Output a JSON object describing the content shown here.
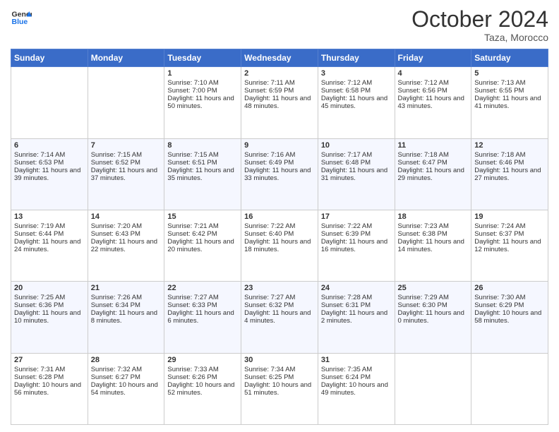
{
  "header": {
    "logo_line1": "General",
    "logo_line2": "Blue",
    "month": "October 2024",
    "location": "Taza, Morocco"
  },
  "days_of_week": [
    "Sunday",
    "Monday",
    "Tuesday",
    "Wednesday",
    "Thursday",
    "Friday",
    "Saturday"
  ],
  "weeks": [
    [
      {
        "day": "",
        "sunrise": "",
        "sunset": "",
        "daylight": ""
      },
      {
        "day": "",
        "sunrise": "",
        "sunset": "",
        "daylight": ""
      },
      {
        "day": "1",
        "sunrise": "Sunrise: 7:10 AM",
        "sunset": "Sunset: 7:00 PM",
        "daylight": "Daylight: 11 hours and 50 minutes."
      },
      {
        "day": "2",
        "sunrise": "Sunrise: 7:11 AM",
        "sunset": "Sunset: 6:59 PM",
        "daylight": "Daylight: 11 hours and 48 minutes."
      },
      {
        "day": "3",
        "sunrise": "Sunrise: 7:12 AM",
        "sunset": "Sunset: 6:58 PM",
        "daylight": "Daylight: 11 hours and 45 minutes."
      },
      {
        "day": "4",
        "sunrise": "Sunrise: 7:12 AM",
        "sunset": "Sunset: 6:56 PM",
        "daylight": "Daylight: 11 hours and 43 minutes."
      },
      {
        "day": "5",
        "sunrise": "Sunrise: 7:13 AM",
        "sunset": "Sunset: 6:55 PM",
        "daylight": "Daylight: 11 hours and 41 minutes."
      }
    ],
    [
      {
        "day": "6",
        "sunrise": "Sunrise: 7:14 AM",
        "sunset": "Sunset: 6:53 PM",
        "daylight": "Daylight: 11 hours and 39 minutes."
      },
      {
        "day": "7",
        "sunrise": "Sunrise: 7:15 AM",
        "sunset": "Sunset: 6:52 PM",
        "daylight": "Daylight: 11 hours and 37 minutes."
      },
      {
        "day": "8",
        "sunrise": "Sunrise: 7:15 AM",
        "sunset": "Sunset: 6:51 PM",
        "daylight": "Daylight: 11 hours and 35 minutes."
      },
      {
        "day": "9",
        "sunrise": "Sunrise: 7:16 AM",
        "sunset": "Sunset: 6:49 PM",
        "daylight": "Daylight: 11 hours and 33 minutes."
      },
      {
        "day": "10",
        "sunrise": "Sunrise: 7:17 AM",
        "sunset": "Sunset: 6:48 PM",
        "daylight": "Daylight: 11 hours and 31 minutes."
      },
      {
        "day": "11",
        "sunrise": "Sunrise: 7:18 AM",
        "sunset": "Sunset: 6:47 PM",
        "daylight": "Daylight: 11 hours and 29 minutes."
      },
      {
        "day": "12",
        "sunrise": "Sunrise: 7:18 AM",
        "sunset": "Sunset: 6:46 PM",
        "daylight": "Daylight: 11 hours and 27 minutes."
      }
    ],
    [
      {
        "day": "13",
        "sunrise": "Sunrise: 7:19 AM",
        "sunset": "Sunset: 6:44 PM",
        "daylight": "Daylight: 11 hours and 24 minutes."
      },
      {
        "day": "14",
        "sunrise": "Sunrise: 7:20 AM",
        "sunset": "Sunset: 6:43 PM",
        "daylight": "Daylight: 11 hours and 22 minutes."
      },
      {
        "day": "15",
        "sunrise": "Sunrise: 7:21 AM",
        "sunset": "Sunset: 6:42 PM",
        "daylight": "Daylight: 11 hours and 20 minutes."
      },
      {
        "day": "16",
        "sunrise": "Sunrise: 7:22 AM",
        "sunset": "Sunset: 6:40 PM",
        "daylight": "Daylight: 11 hours and 18 minutes."
      },
      {
        "day": "17",
        "sunrise": "Sunrise: 7:22 AM",
        "sunset": "Sunset: 6:39 PM",
        "daylight": "Daylight: 11 hours and 16 minutes."
      },
      {
        "day": "18",
        "sunrise": "Sunrise: 7:23 AM",
        "sunset": "Sunset: 6:38 PM",
        "daylight": "Daylight: 11 hours and 14 minutes."
      },
      {
        "day": "19",
        "sunrise": "Sunrise: 7:24 AM",
        "sunset": "Sunset: 6:37 PM",
        "daylight": "Daylight: 11 hours and 12 minutes."
      }
    ],
    [
      {
        "day": "20",
        "sunrise": "Sunrise: 7:25 AM",
        "sunset": "Sunset: 6:36 PM",
        "daylight": "Daylight: 11 hours and 10 minutes."
      },
      {
        "day": "21",
        "sunrise": "Sunrise: 7:26 AM",
        "sunset": "Sunset: 6:34 PM",
        "daylight": "Daylight: 11 hours and 8 minutes."
      },
      {
        "day": "22",
        "sunrise": "Sunrise: 7:27 AM",
        "sunset": "Sunset: 6:33 PM",
        "daylight": "Daylight: 11 hours and 6 minutes."
      },
      {
        "day": "23",
        "sunrise": "Sunrise: 7:27 AM",
        "sunset": "Sunset: 6:32 PM",
        "daylight": "Daylight: 11 hours and 4 minutes."
      },
      {
        "day": "24",
        "sunrise": "Sunrise: 7:28 AM",
        "sunset": "Sunset: 6:31 PM",
        "daylight": "Daylight: 11 hours and 2 minutes."
      },
      {
        "day": "25",
        "sunrise": "Sunrise: 7:29 AM",
        "sunset": "Sunset: 6:30 PM",
        "daylight": "Daylight: 11 hours and 0 minutes."
      },
      {
        "day": "26",
        "sunrise": "Sunrise: 7:30 AM",
        "sunset": "Sunset: 6:29 PM",
        "daylight": "Daylight: 10 hours and 58 minutes."
      }
    ],
    [
      {
        "day": "27",
        "sunrise": "Sunrise: 7:31 AM",
        "sunset": "Sunset: 6:28 PM",
        "daylight": "Daylight: 10 hours and 56 minutes."
      },
      {
        "day": "28",
        "sunrise": "Sunrise: 7:32 AM",
        "sunset": "Sunset: 6:27 PM",
        "daylight": "Daylight: 10 hours and 54 minutes."
      },
      {
        "day": "29",
        "sunrise": "Sunrise: 7:33 AM",
        "sunset": "Sunset: 6:26 PM",
        "daylight": "Daylight: 10 hours and 52 minutes."
      },
      {
        "day": "30",
        "sunrise": "Sunrise: 7:34 AM",
        "sunset": "Sunset: 6:25 PM",
        "daylight": "Daylight: 10 hours and 51 minutes."
      },
      {
        "day": "31",
        "sunrise": "Sunrise: 7:35 AM",
        "sunset": "Sunset: 6:24 PM",
        "daylight": "Daylight: 10 hours and 49 minutes."
      },
      {
        "day": "",
        "sunrise": "",
        "sunset": "",
        "daylight": ""
      },
      {
        "day": "",
        "sunrise": "",
        "sunset": "",
        "daylight": ""
      }
    ]
  ]
}
